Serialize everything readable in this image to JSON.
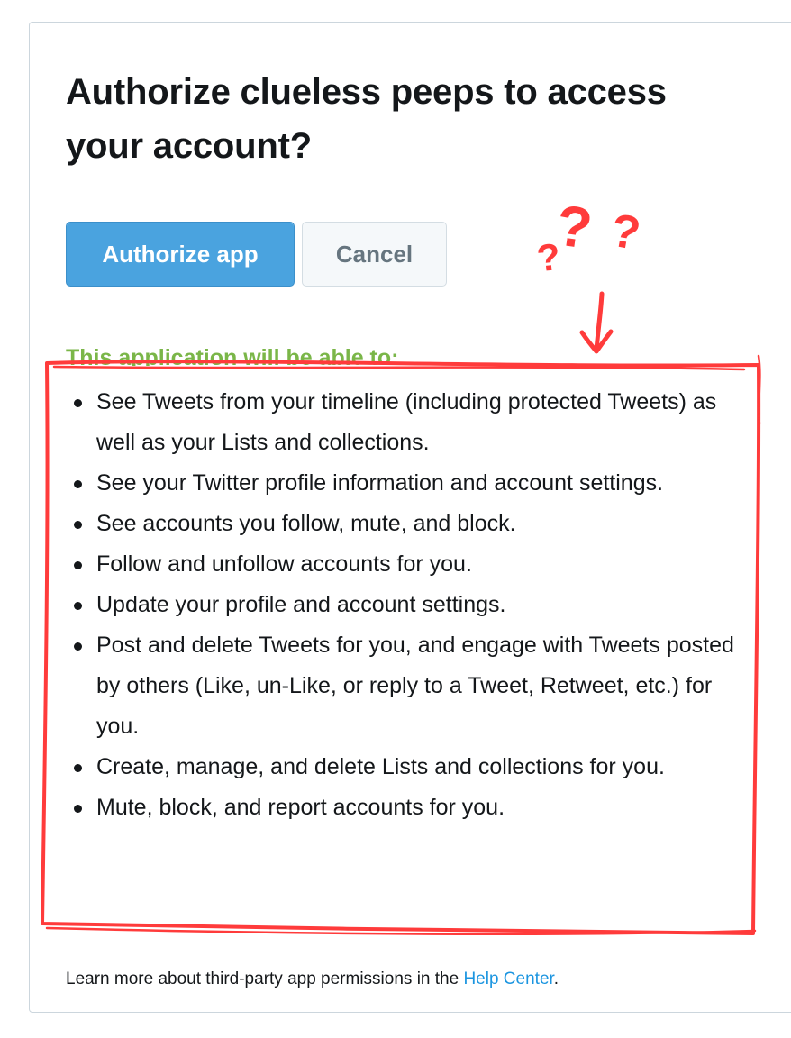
{
  "dialog": {
    "title": "Authorize clueless peeps to access your account?",
    "authorize_label": "Authorize app",
    "cancel_label": "Cancel",
    "permissions_heading": "This application will be able to:",
    "permissions": [
      "See Tweets from your timeline (including protected Tweets) as well as your Lists and collections.",
      "See your Twitter profile information and account settings.",
      "See accounts you follow, mute, and block.",
      "Follow and unfollow accounts for you.",
      "Update your profile and account settings.",
      "Post and delete Tweets for you, and engage with Tweets posted by others (Like, un-Like, or reply to a Tweet, Retweet, etc.) for you.",
      "Create, manage, and delete Lists and collections for you.",
      "Mute, block, and report accounts for you."
    ],
    "footer_prefix": "Learn more about third-party app permissions in the ",
    "footer_link": "Help Center",
    "footer_suffix": "."
  },
  "annotation": {
    "glyphs": [
      "?",
      "?",
      "?"
    ],
    "color": "#ff3b3b"
  },
  "colors": {
    "primary_button": "#4aa3df",
    "heading_green": "#7ab648",
    "link": "#1b95e0",
    "annotation_red": "#ff3b3b"
  }
}
